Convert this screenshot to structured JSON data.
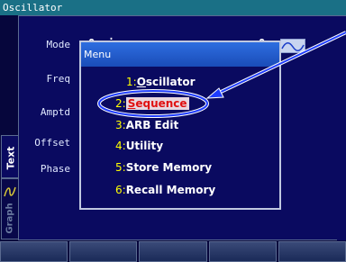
{
  "window": {
    "title": "Oscillator"
  },
  "params": [
    "Mode",
    "Freq",
    "Amptd",
    "Offset",
    "Phase"
  ],
  "background_text": {
    "mode_value": "O..i.",
    "mode_right": "O."
  },
  "tabs": {
    "text": "Text",
    "graph": "Graph"
  },
  "menu": {
    "title": "Menu",
    "items": [
      {
        "num": "1:",
        "label": "Oscillator",
        "first": "O",
        "rest": "scillator"
      },
      {
        "num": "2:",
        "label": "Sequence",
        "first": "S",
        "rest": "equence",
        "selected": true
      },
      {
        "num": "3:",
        "label": "ARB Edit"
      },
      {
        "num": "4:",
        "label": "Utility"
      },
      {
        "num": "5:",
        "label": "Store Memory"
      },
      {
        "num": "6:",
        "label": "Recall Memory"
      }
    ]
  },
  "annotation": {
    "highlight": "Sequence",
    "color": "#1e3cff"
  },
  "softkeys": [
    "",
    "",
    "",
    "",
    ""
  ],
  "colors": {
    "screen_bg": "#06063c",
    "panel_bg": "#0a0a60",
    "title_bar": "#1a7086",
    "menu_title": "#1a4cb8",
    "menu_number": "#ffff00",
    "selected_text": "#e01010",
    "annotation": "#1e3cff"
  }
}
